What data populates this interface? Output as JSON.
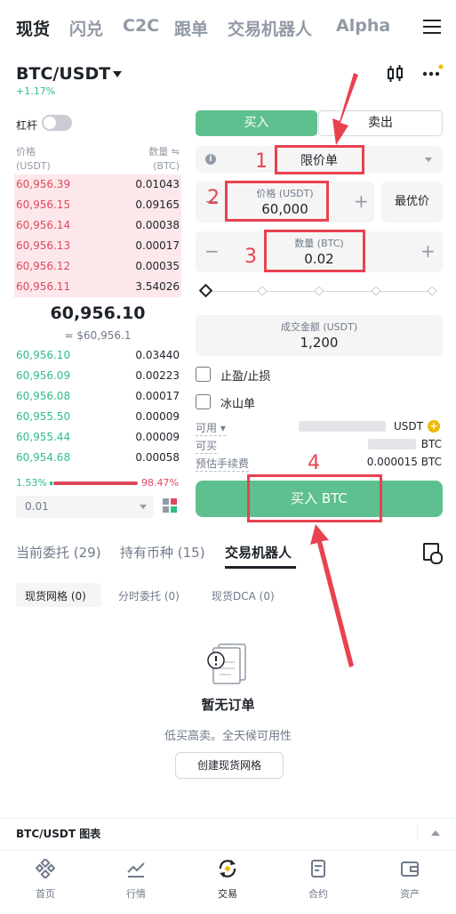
{
  "nav": {
    "tabs": [
      "现货",
      "闪兑",
      "C2C",
      "跟单",
      "交易机器人",
      "Alpha"
    ],
    "active": "现货"
  },
  "pair": {
    "symbol": "BTC/USDT",
    "change": "+1.17%"
  },
  "orderbook": {
    "leverage_label": "杠杆",
    "price_header": "价格",
    "price_unit": "(USDT)",
    "qty_header": "数量 ⇋",
    "qty_unit": "(BTC)",
    "asks": [
      {
        "price": "60,956.39",
        "qty": "0.01043"
      },
      {
        "price": "60,956.15",
        "qty": "0.09165"
      },
      {
        "price": "60,956.14",
        "qty": "0.00038"
      },
      {
        "price": "60,956.13",
        "qty": "0.00017"
      },
      {
        "price": "60,956.12",
        "qty": "0.00035"
      },
      {
        "price": "60,956.11",
        "qty": "3.54026"
      }
    ],
    "last_price": "60,956.10",
    "last_price_usd": "≈ $60,956.1",
    "bids": [
      {
        "price": "60,956.10",
        "qty": "0.03440"
      },
      {
        "price": "60,956.09",
        "qty": "0.00223"
      },
      {
        "price": "60,956.08",
        "qty": "0.00017"
      },
      {
        "price": "60,955.50",
        "qty": "0.00009"
      },
      {
        "price": "60,955.44",
        "qty": "0.00009"
      },
      {
        "price": "60,954.68",
        "qty": "0.00058"
      }
    ],
    "buy_ratio": "1.53%",
    "sell_ratio": "98.47%",
    "precision": "0.01"
  },
  "order_form": {
    "buy_tab": "买入",
    "sell_tab": "卖出",
    "order_type": "限价单",
    "price_label": "价格 (USDT)",
    "price_value": "60,000",
    "best_price_button": "最优价",
    "qty_label": "数量 (BTC)",
    "qty_value": "0.02",
    "total_label": "成交金额 (USDT)",
    "total_value": "1,200",
    "tp_sl_label": "止盈/止损",
    "iceberg_label": "冰山单",
    "available_label": "可用 ▾",
    "available_unit": "USDT",
    "can_buy_label": "可买",
    "can_buy_unit": "BTC",
    "fee_label": "预估手续费",
    "fee_value": "0.000015 BTC",
    "submit_button": "买入 BTC"
  },
  "annotations": [
    "1",
    "2",
    "3",
    "4"
  ],
  "orders": {
    "tabs": [
      "当前委托 (29)",
      "持有币种 (15)",
      "交易机器人"
    ],
    "active_tab": "交易机器人",
    "subtabs": [
      "现货网格 (0)",
      "分时委托 (0)",
      "现货DCA (0)"
    ],
    "empty_title": "暂无订单",
    "empty_subtitle": "低买高卖。全天候可用性",
    "create_button": "创建现货网格"
  },
  "chart_bar": {
    "label": "BTC/USDT 图表"
  },
  "bottom_nav": [
    {
      "label": "首页",
      "icon": "home-icon"
    },
    {
      "label": "行情",
      "icon": "markets-icon"
    },
    {
      "label": "交易",
      "icon": "trade-icon"
    },
    {
      "label": "合约",
      "icon": "futures-icon"
    },
    {
      "label": "资产",
      "icon": "wallet-icon"
    }
  ],
  "colors": {
    "buy": "#5ec08e",
    "sell": "#e0465e",
    "annotation": "#e8424f"
  }
}
